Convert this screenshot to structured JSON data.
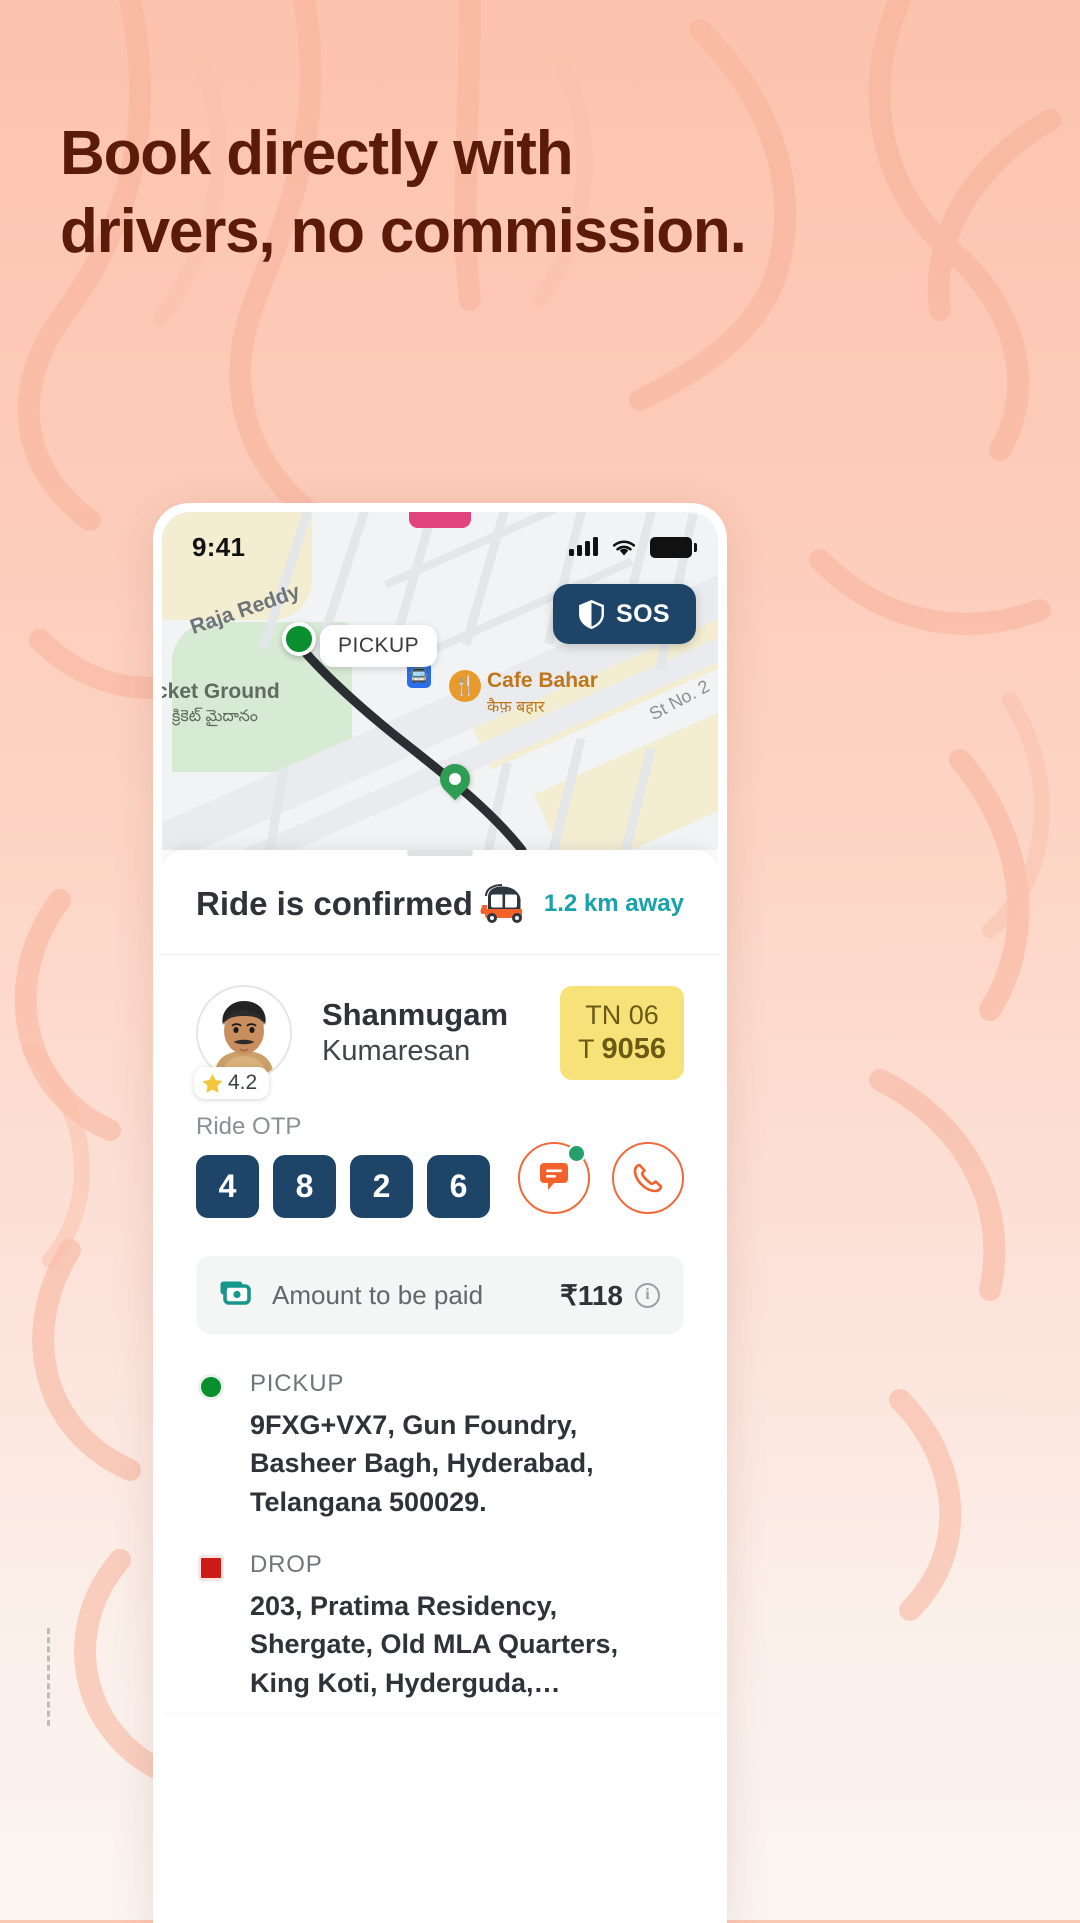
{
  "headline": {
    "line1": "Book directly with",
    "line2": "drivers, no commission.",
    "color": "#5C1B08"
  },
  "background": {
    "color": "#FCC6B1"
  },
  "phone": {
    "status_bar": {
      "time": "9:41",
      "signal_icon": "cellular-signal-icon",
      "wifi_icon": "wifi-icon",
      "battery_icon": "battery-full-icon"
    },
    "map": {
      "sos_button": {
        "label": "SOS",
        "icon": "shield-icon",
        "color": "#1E4468"
      },
      "pickup_pill": "PICKUP",
      "pickup_marker_color": "#0A8F2E",
      "labels": {
        "road": "Raja Reddy",
        "cafe_name": "Cafe Bahar",
        "cafe_name_local": "कैफ़ बहार",
        "street_no": "St No. 2",
        "ground": "cket Ground",
        "ground_local": "క్రికెట్ మైదానం"
      },
      "poi_icons": {
        "bus": "bus-stop-icon",
        "restaurant": "restaurant-icon",
        "pin": "location-pin-icon"
      }
    },
    "sheet": {
      "title": "Ride is confirmed",
      "vehicle_icon": "auto-rickshaw-icon",
      "distance_away": "1.2 km away",
      "distance_color": "#18A2AB",
      "driver": {
        "first_name": "Shanmugam",
        "last_name": "Kumaresan",
        "rating": "4.2",
        "rating_icon": "star-icon",
        "avatar_icon": "driver-avatar",
        "plate_line1": "TN 06",
        "plate_line2_prefix": "T ",
        "plate_line2_number": "9056",
        "plate_color": "#F7E27A"
      },
      "otp": {
        "label": "Ride OTP",
        "digits": [
          "4",
          "8",
          "2",
          "6"
        ],
        "box_color": "#1E4468"
      },
      "actions": {
        "chat_icon": "chat-message-icon",
        "call_icon": "phone-call-icon",
        "unread_indicator_color": "#23A06A"
      },
      "amount": {
        "icon": "cash-payment-icon",
        "label": "Amount to be paid",
        "value": "₹118",
        "info_icon": "info-icon"
      },
      "trip": {
        "pickup_label": "PICKUP",
        "pickup_address": "9FXG+VX7, Gun Foundry, Basheer Bagh, Hyderabad, Telangana 500029.",
        "drop_label": "DROP",
        "drop_address": "203, Pratima Residency, Shergate, Old MLA Quarters, King Koti, Hyderguda,…"
      }
    }
  }
}
